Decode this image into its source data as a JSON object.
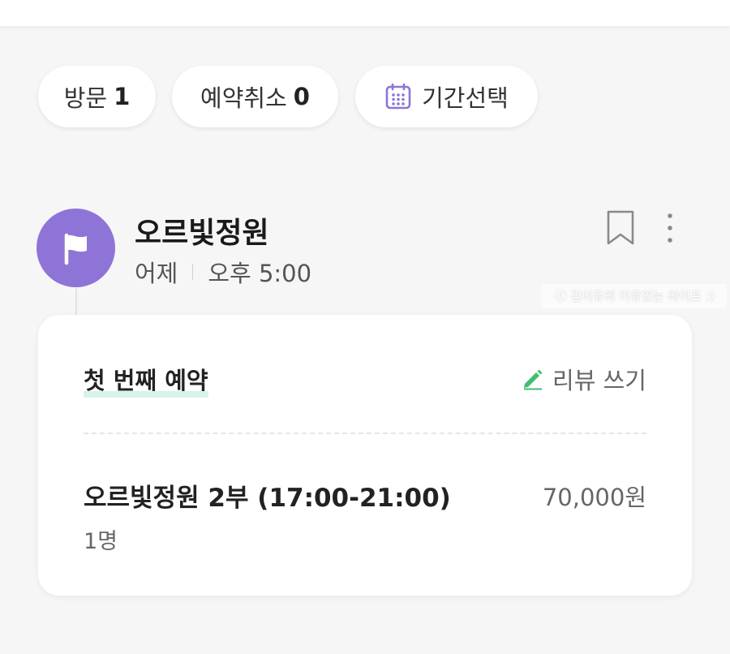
{
  "filters": {
    "visit_label": "방문",
    "visit_count": "1",
    "cancel_label": "예약취소",
    "cancel_count": "0",
    "period_label": "기간선택",
    "period_icon": "calendar-icon"
  },
  "reservation": {
    "place_name": "오르빛정원",
    "day": "어제",
    "time": "오후 5:00",
    "avatar_icon": "flag-icon",
    "avatar_color": "#8f74d8"
  },
  "watermark": "ⓒ 김이유의 이유있는 라이프 :)",
  "card": {
    "title": "첫 번째 예약",
    "review_label": "리뷰 쓰기",
    "item_name": "오르빛정원 2부 (17:00-21:00)",
    "item_price": "70,000원",
    "item_people": "1명"
  },
  "colors": {
    "accent_purple": "#8f74d8",
    "pencil_green": "#3fbf70",
    "highlight_mint": "#d7f3ea"
  }
}
